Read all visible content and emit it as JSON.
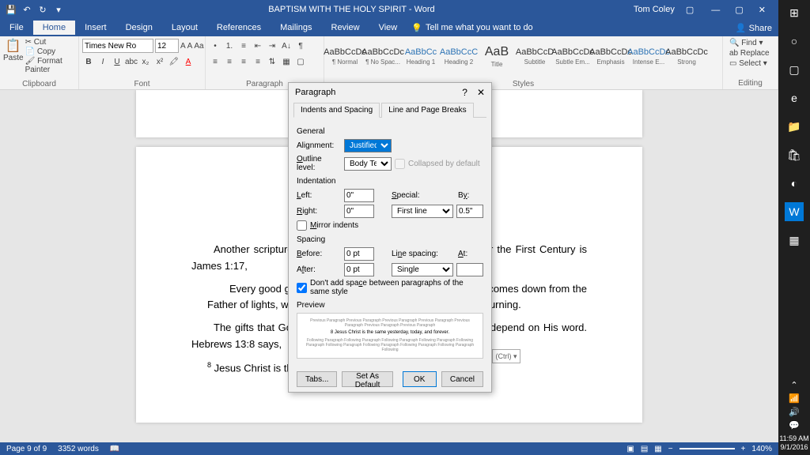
{
  "titlebar": {
    "title": "BAPTISM  WITH THE HOLY SPIRIT - Word",
    "user": "Tom Coley"
  },
  "menu": {
    "file": "File",
    "home": "Home",
    "insert": "Insert",
    "design": "Design",
    "layout": "Layout",
    "references": "References",
    "mailings": "Mailings",
    "review": "Review",
    "view": "View",
    "tell": "Tell me what you want to do",
    "share": "Share"
  },
  "ribbon": {
    "clipboard": {
      "paste": "Paste",
      "cut": "Cut",
      "copy": "Copy",
      "format_painter": "Format Painter",
      "label": "Clipboard"
    },
    "font": {
      "name": "Times New Ro",
      "size": "12",
      "label": "Font"
    },
    "paragraph": {
      "label": "Paragraph"
    },
    "styles": {
      "items": [
        {
          "prev": "AaBbCcDc",
          "name": "¶ Normal",
          "cls": ""
        },
        {
          "prev": "AaBbCcDc",
          "name": "¶ No Spac...",
          "cls": ""
        },
        {
          "prev": "AaBbCc",
          "name": "Heading 1",
          "cls": "blue"
        },
        {
          "prev": "AaBbCcC",
          "name": "Heading 2",
          "cls": "blue"
        },
        {
          "prev": "AaB",
          "name": "Title",
          "cls": "big"
        },
        {
          "prev": "AaBbCcD",
          "name": "Subtitle",
          "cls": ""
        },
        {
          "prev": "AaBbCcDc",
          "name": "Subtle Em...",
          "cls": ""
        },
        {
          "prev": "AaBbCcDc",
          "name": "Emphasis",
          "cls": ""
        },
        {
          "prev": "AaBbCcDc",
          "name": "Intense E...",
          "cls": "blue"
        },
        {
          "prev": "AaBbCcDc",
          "name": "Strong",
          "cls": ""
        }
      ],
      "label": "Styles"
    },
    "editing": {
      "find": "Find",
      "replace": "Replace",
      "select": "Select",
      "label": "Editing"
    }
  },
  "document": {
    "p1": "Another scripture that teaches that this gift was not only for the First Century is James 1:17,",
    "p2": "Every good gift and every perfect gift is from above, and comes down from the Father of lights, with whom there is no variation or shadow of turning.",
    "p3": "The gifts that God gives are good and perfect, and we can depend on His word. Hebrews 13:8 says,",
    "p4": "Jesus Christ is the same yesterday, today, and forever.",
    "sup": "8"
  },
  "dialog": {
    "title": "Paragraph",
    "tab1": "Indents and Spacing",
    "tab2": "Line and Page Breaks",
    "general": "General",
    "alignment_label": "Alignment:",
    "alignment": "Justified",
    "outline_label": "Outline level:",
    "outline": "Body Text",
    "collapsed": "Collapsed by default",
    "indentation": "Indentation",
    "left_label": "Left:",
    "left": "0\"",
    "right_label": "Right:",
    "right": "0\"",
    "special_label": "Special:",
    "special": "First line",
    "by_label": "By:",
    "by": "0.5\"",
    "mirror": "Mirror indents",
    "spacing": "Spacing",
    "before_label": "Before:",
    "before": "0 pt",
    "after_label": "After:",
    "after": "0 pt",
    "line_label": "Line spacing:",
    "line": "Single",
    "at_label": "At:",
    "at": "",
    "dont_add": "Don't add space between paragraphs of the same style",
    "preview": "Preview",
    "preview_mid": "8 Jesus Christ is the same yesterday, today, and forever.",
    "tabs_btn": "Tabs...",
    "default_btn": "Set As Default",
    "ok": "OK",
    "cancel": "Cancel"
  },
  "paste_opts": "(Ctrl) ▾",
  "status": {
    "page": "Page 9 of 9",
    "words": "3352 words",
    "zoom": "140%"
  },
  "tray": {
    "time": "11:59 AM",
    "date": "9/1/2016"
  }
}
